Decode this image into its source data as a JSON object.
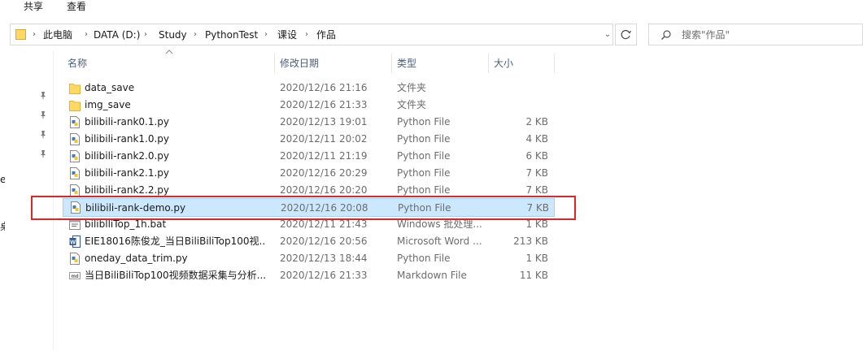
{
  "ribbon": {
    "tabs": [
      "共享",
      "查看"
    ]
  },
  "address": {
    "crumbs": [
      "此电脑",
      "DATA (D:)",
      "Study",
      "PythonTest",
      "课设",
      "作品"
    ]
  },
  "search": {
    "placeholder": "搜索\"作品\""
  },
  "nav": {
    "fragments": [
      "e",
      "桌"
    ]
  },
  "columns": {
    "name": "名称",
    "date": "修改日期",
    "type": "类型",
    "size": "大小"
  },
  "files": [
    {
      "name": "data_save",
      "date": "2020/12/16 21:16",
      "type": "文件夹",
      "size": "",
      "icon": "folder-icon"
    },
    {
      "name": "img_save",
      "date": "2020/12/16 21:33",
      "type": "文件夹",
      "size": "",
      "icon": "folder-icon"
    },
    {
      "name": "bilibili-rank0.1.py",
      "date": "2020/12/13 19:01",
      "type": "Python File",
      "size": "2 KB",
      "icon": "python-file-icon"
    },
    {
      "name": "bilibili-rank1.0.py",
      "date": "2020/12/11 20:02",
      "type": "Python File",
      "size": "4 KB",
      "icon": "python-file-icon"
    },
    {
      "name": "bilibili-rank2.0.py",
      "date": "2020/12/11 21:19",
      "type": "Python File",
      "size": "6 KB",
      "icon": "python-file-icon"
    },
    {
      "name": "bilibili-rank2.1.py",
      "date": "2020/12/16 20:29",
      "type": "Python File",
      "size": "7 KB",
      "icon": "python-file-icon"
    },
    {
      "name": "bilibili-rank2.2.py",
      "date": "2020/12/16 20:20",
      "type": "Python File",
      "size": "7 KB",
      "icon": "python-file-icon"
    },
    {
      "name": "bilibili-rank-demo.py",
      "date": "2020/12/16 20:08",
      "type": "Python File",
      "size": "7 KB",
      "icon": "python-file-icon",
      "selected": true
    },
    {
      "name": "biliblliTop_1h.bat",
      "date": "2020/12/11 21:43",
      "type": "Windows 批处理...",
      "size": "1 KB",
      "icon": "batch-file-icon"
    },
    {
      "name": "EIE18016陈俊龙_当日BiliBiliTop100视...",
      "date": "2020/12/16 20:56",
      "type": "Microsoft Word ...",
      "size": "213 KB",
      "icon": "word-file-icon"
    },
    {
      "name": "oneday_data_trim.py",
      "date": "2020/12/13 18:44",
      "type": "Python File",
      "size": "1 KB",
      "icon": "python-file-icon"
    },
    {
      "name": "当日BiliBiliTop100视频数据采集与分析...",
      "date": "2020/12/16 21:33",
      "type": "Markdown File",
      "size": "11 KB",
      "icon": "markdown-file-icon"
    }
  ],
  "colors": {
    "selection": "#cce8ff",
    "selection_border": "#99d1ff",
    "highlight_box": "#e0242a",
    "folder": "#ffd866"
  }
}
